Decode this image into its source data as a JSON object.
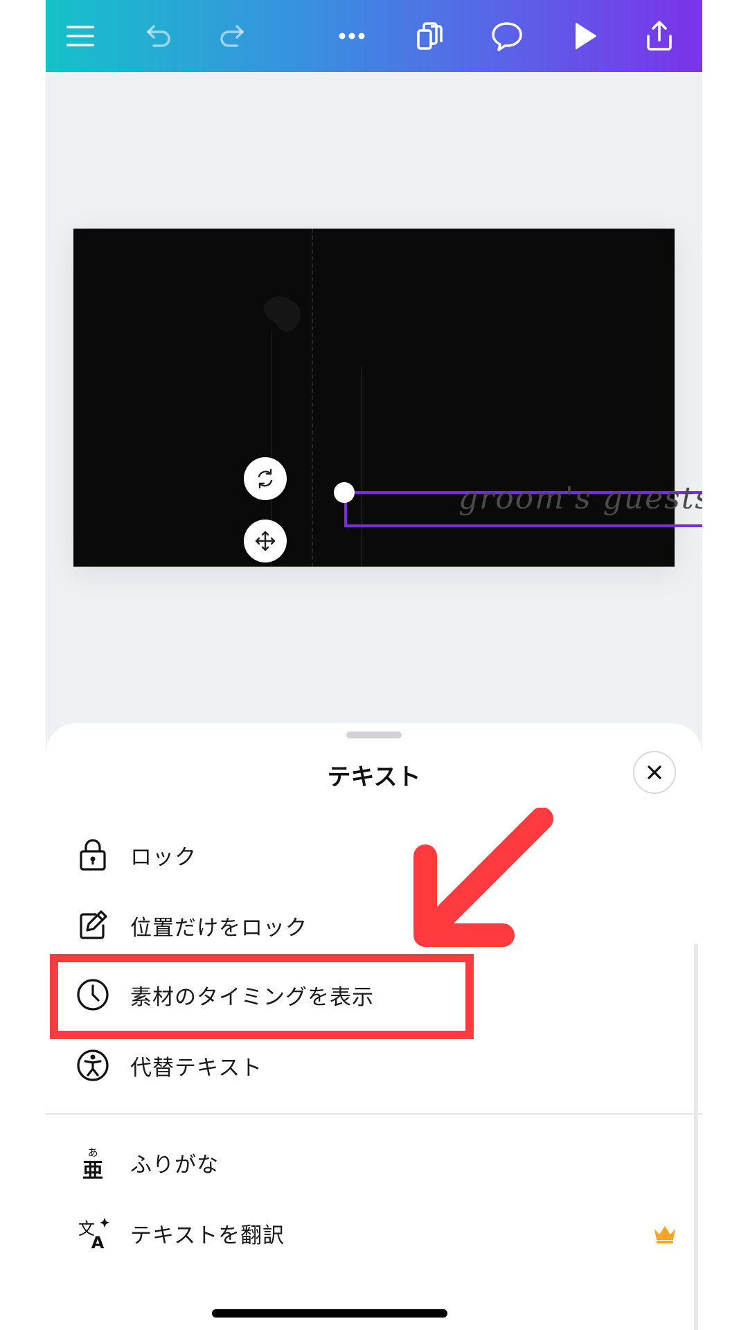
{
  "toolbar": {
    "icons": [
      "menu-icon",
      "undo-icon",
      "redo-icon",
      "more-icon",
      "duplicate-pages-icon",
      "comment-icon",
      "play-icon",
      "share-icon"
    ]
  },
  "canvas": {
    "text_element": "groom's guests",
    "handles": [
      "rotate-icon",
      "move-icon"
    ],
    "selection_color": "#7d2ae8"
  },
  "sheet": {
    "title": "テキスト",
    "items": [
      {
        "label": "ロック",
        "icon": "lock-icon"
      },
      {
        "label": "位置だけをロック",
        "icon": "edit-lock-icon"
      },
      {
        "label": "素材のタイミングを表示",
        "icon": "clock-icon"
      },
      {
        "label": "代替テキスト",
        "icon": "accessibility-icon"
      },
      {
        "label": "ふりがな",
        "icon": "furigana-icon"
      },
      {
        "label": "テキストを翻訳",
        "icon": "translate-icon"
      }
    ],
    "premium_icon": "crown-icon"
  },
  "annotation": {
    "highlight_color": "#ff3b3f"
  }
}
